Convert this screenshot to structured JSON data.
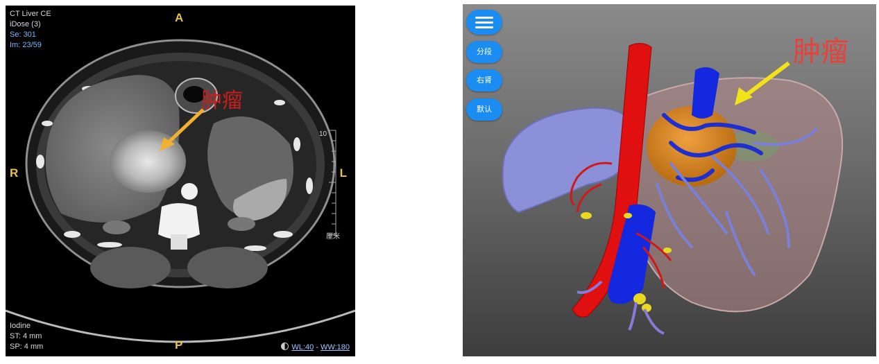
{
  "ct_view": {
    "header": {
      "study": "CT Liver CE",
      "recon": "iDose (3)",
      "series": "Se: 301",
      "image": "Im: 23/59"
    },
    "orientation": {
      "anterior": "A",
      "posterior": "P",
      "right": "R",
      "left": "L"
    },
    "footer": {
      "contrast": "Iodine",
      "st": "ST: 4 mm",
      "sp": "SP: 4 mm"
    },
    "window": {
      "wl": "WL:40",
      "separator": "-",
      "ww": "WW:180"
    },
    "scale": {
      "top_label": "10",
      "unit": "厘米"
    },
    "annotation": {
      "label": "肿瘤",
      "color": "#c81e1e",
      "arrow_color": "#f0b030"
    }
  },
  "model_view": {
    "toolbar": {
      "menu_icon": "hamburger-menu-icon",
      "buttons": [
        "分段",
        "右肾",
        "默认"
      ],
      "button_color": "#1a8cf2"
    },
    "annotation": {
      "label": "肿瘤",
      "color": "#e8413a",
      "arrow_color": "#f2e21a"
    }
  }
}
